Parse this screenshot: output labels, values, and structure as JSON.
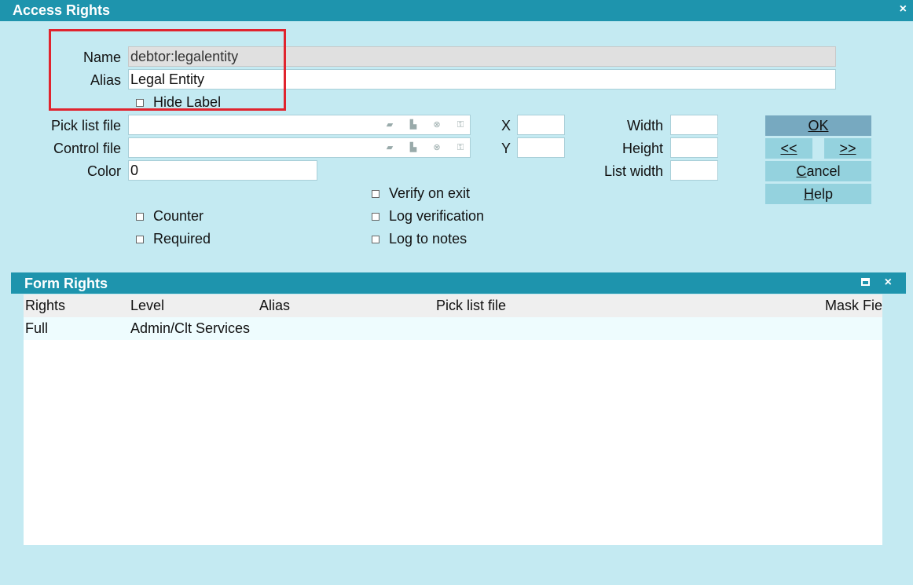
{
  "window": {
    "title": "Access Rights",
    "close_glyph": "×"
  },
  "form": {
    "name_label": "Name",
    "name_value": "debtor:legalentity",
    "alias_label": "Alias",
    "alias_value": "Legal Entity",
    "hide_label": "Hide Label",
    "picklist_label": "Pick list file",
    "control_label": "Control file",
    "color_label": "Color",
    "color_value": "0",
    "x_label": "X",
    "y_label": "Y",
    "width_label": "Width",
    "height_label": "Height",
    "listwidth_label": "List width",
    "checkboxes": {
      "verify_on_exit": "Verify on exit",
      "counter": "Counter",
      "log_verification": "Log verification",
      "required": "Required",
      "log_to_notes": "Log to notes"
    }
  },
  "picker_icons": [
    "folder-icon",
    "printer-icon",
    "clear-icon",
    "lookup-icon"
  ],
  "buttons": {
    "ok": "OK",
    "prev": "<<",
    "next": ">>",
    "cancel_first": "C",
    "cancel_rest": "ancel",
    "help_first": "H",
    "help_rest": "elp"
  },
  "form_rights": {
    "title": "Form Rights",
    "columns": [
      "Rights",
      "Level",
      "Alias",
      "Pick list file",
      "Mask Fie"
    ],
    "rows": [
      {
        "rights": "Full",
        "level": "Admin/Clt Services",
        "alias": "",
        "picklist": "",
        "mask": ""
      }
    ]
  },
  "colors": {
    "titlebar": "#1e94ad",
    "background": "#c4eaf2",
    "button": "#94d2de",
    "primary_button": "#77a9c0",
    "highlight": "#e0242e"
  }
}
